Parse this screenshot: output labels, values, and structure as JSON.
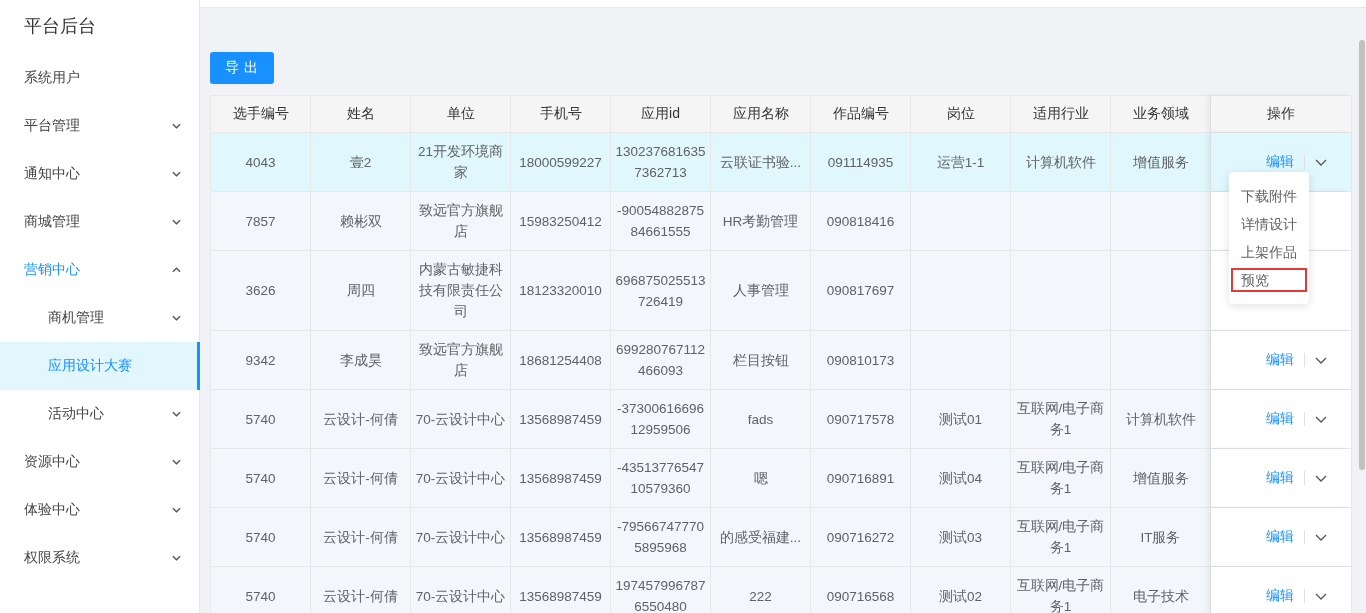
{
  "sidebar": {
    "title": "平台后台",
    "items": [
      {
        "label": "系统用户",
        "kind": "link",
        "selected": false
      },
      {
        "label": "平台管理",
        "kind": "group",
        "expanded": false,
        "selected": false
      },
      {
        "label": "通知中心",
        "kind": "group",
        "expanded": false,
        "selected": false
      },
      {
        "label": "商城管理",
        "kind": "group",
        "expanded": false,
        "selected": false
      },
      {
        "label": "营销中心",
        "kind": "group",
        "expanded": true,
        "selected": false,
        "children": [
          {
            "label": "商机管理",
            "kind": "group",
            "expanded": false,
            "selected": false
          },
          {
            "label": "应用设计大赛",
            "kind": "link",
            "selected": true
          },
          {
            "label": "活动中心",
            "kind": "group",
            "expanded": false,
            "selected": false
          }
        ]
      },
      {
        "label": "资源中心",
        "kind": "group",
        "expanded": false,
        "selected": false
      },
      {
        "label": "体验中心",
        "kind": "group",
        "expanded": false,
        "selected": false
      },
      {
        "label": "权限系统",
        "kind": "group",
        "expanded": false,
        "selected": false
      }
    ]
  },
  "export_button": "导 出",
  "table": {
    "columns": [
      "选手编号",
      "姓名",
      "单位",
      "手机号",
      "应用id",
      "应用名称",
      "作品编号",
      "岗位",
      "适用行业",
      "业务领域",
      "操作"
    ],
    "rows": [
      {
        "selected": true,
        "show_actions": true,
        "cells": [
          "4043",
          "壹2",
          "21开发环境商家",
          "18000599227",
          "1302376816357362713",
          "云联证书验...",
          "091114935",
          "运营1-1",
          "计算机软件",
          "增值服务"
        ],
        "edit": "编辑"
      },
      {
        "selected": false,
        "show_actions": false,
        "cells": [
          "7857",
          "赖彬双",
          "致远官方旗舰店",
          "15983250412",
          "-9005488287584661555",
          "HR考勤管理",
          "090818416",
          "",
          "",
          ""
        ]
      },
      {
        "selected": false,
        "show_actions": false,
        "cells": [
          "3626",
          "周四",
          "内蒙古敏捷科技有限责任公司",
          "18123320010",
          "696875025513726419",
          "人事管理",
          "090817697",
          "",
          "",
          ""
        ]
      },
      {
        "selected": false,
        "show_actions": true,
        "cells": [
          "9342",
          "李成昊",
          "致远官方旗舰店",
          "18681254408",
          "699280767112466093",
          "栏目按钮",
          "090810173",
          "",
          "",
          ""
        ],
        "edit": "编辑"
      },
      {
        "selected": false,
        "show_actions": true,
        "cells": [
          "5740",
          "云设计-何倩",
          "70-云设计中心",
          "13568987459",
          "-3730061669612959506",
          "fads",
          "090717578",
          "测试01",
          "互联网/电子商务1",
          "计算机软件"
        ],
        "edit": "编辑"
      },
      {
        "selected": false,
        "show_actions": true,
        "cells": [
          "5740",
          "云设计-何倩",
          "70-云设计中心",
          "13568987459",
          "-4351377654710579360",
          "嗯",
          "090716891",
          "测试04",
          "互联网/电子商务1",
          "增值服务"
        ],
        "edit": "编辑"
      },
      {
        "selected": false,
        "show_actions": true,
        "cells": [
          "5740",
          "云设计-何倩",
          "70-云设计中心",
          "13568987459",
          "-795667477705895968",
          "的感受福建...",
          "090716272",
          "测试03",
          "互联网/电子商务1",
          "IT服务"
        ],
        "edit": "编辑"
      },
      {
        "selected": false,
        "show_actions": true,
        "cells": [
          "5740",
          "云设计-何倩",
          "70-云设计中心",
          "13568987459",
          "1974579967876550480",
          "222",
          "090716568",
          "测试02",
          "互联网/电子商务1",
          "电子技术"
        ],
        "edit": "编辑"
      }
    ]
  },
  "dropdown_menu": {
    "items": [
      {
        "label": "下载附件",
        "highlighted": false
      },
      {
        "label": "详情设计",
        "highlighted": false
      },
      {
        "label": "上架作品",
        "highlighted": false
      },
      {
        "label": "预览",
        "highlighted": true
      }
    ]
  }
}
